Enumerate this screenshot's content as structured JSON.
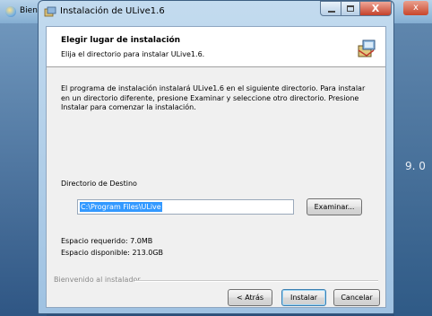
{
  "background_window": {
    "title": "Bien",
    "close_label": "x",
    "version_text": "9. 0"
  },
  "window": {
    "title": "Instalación de ULive1.6",
    "close_label": "X"
  },
  "header": {
    "title": "Elegir lugar de instalación",
    "subtitle": "Elija el directorio para instalar ULive1.6."
  },
  "description": "El programa de instalación instalará ULive1.6 en el siguiente directorio. Para instalar en un directorio diferente, presione Examinar y seleccione otro directorio. Presione Instalar para comenzar la instalación.",
  "destination": {
    "group_label": "Directorio de Destino",
    "path_value": "C:\\Program Files\\ULive",
    "browse_label": "Examinar..."
  },
  "space": {
    "required": "Espacio requerido: 7.0MB",
    "available": "Espacio disponible: 213.0GB"
  },
  "branding": "Bienvenido al instalador",
  "buttons": {
    "back": "< Atrás",
    "install": "Instalar",
    "cancel": "Cancelar"
  },
  "colors": {
    "selection": "#3399ff",
    "close_button": "#c4412a"
  }
}
